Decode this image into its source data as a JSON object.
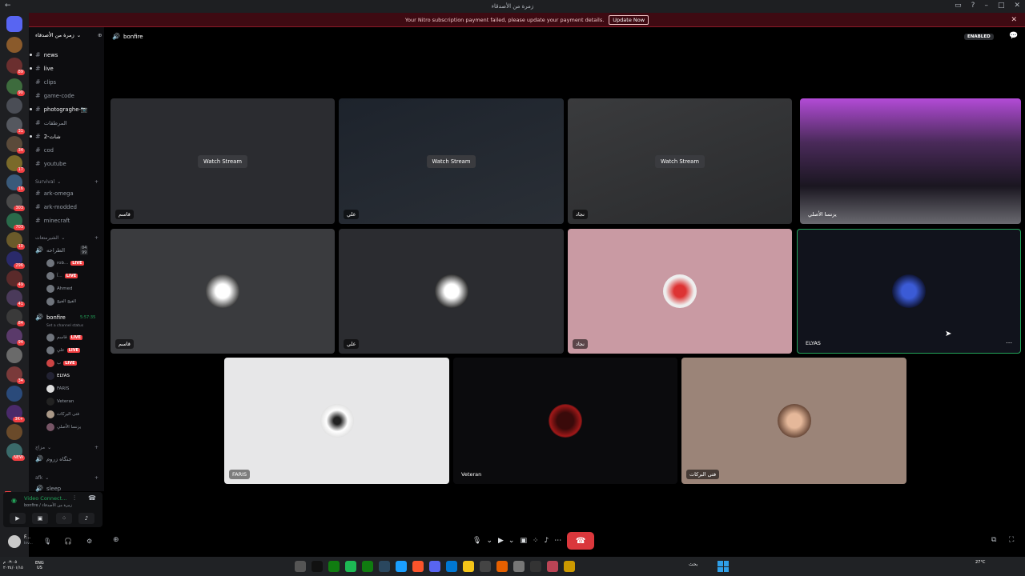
{
  "window": {
    "title": "زمرة من الأصدقاء"
  },
  "banner": {
    "message": "Your Nitro subscription payment failed, please update your payment details.",
    "button": "Update Now"
  },
  "server": {
    "name": "زمرة من الأصدقاء"
  },
  "guild_badges": [
    "89",
    "90",
    "31",
    "34",
    "17",
    "16",
    "303",
    "703",
    "10",
    "296",
    "49",
    "41",
    "84",
    "94",
    "34",
    "3K+",
    "NEW"
  ],
  "channels": [
    "news",
    "live",
    "clips",
    "game-code",
    "photograghe-📷",
    "المرطقات",
    "شات-2",
    "cod",
    "youtube"
  ],
  "categories": {
    "survival": "Survival",
    "voice": "الشيرمتعات",
    "misc": "مزاج",
    "afk": "afk"
  },
  "survival_channels": [
    "ark-omega",
    "ark-modded",
    "minecraft"
  ],
  "voice_channel_1": {
    "name": "الطراحه",
    "count": "04 99"
  },
  "voice_channel_1_users": [
    {
      "name": "rob...",
      "live": "LIVE"
    },
    {
      "name": "آ...",
      "live": "LIVE"
    },
    {
      "name": "Ahmed",
      "live": ""
    },
    {
      "name": "الفيج الفيج",
      "live": ""
    }
  ],
  "bonfire": {
    "name": "bonfire",
    "timer": "5:57:35",
    "status": "Set a channel status"
  },
  "bonfire_users": [
    {
      "name": "قاسم",
      "live": "LIVE"
    },
    {
      "name": "علي",
      "live": "LIVE"
    },
    {
      "name": "ب",
      "live": "LIVE"
    },
    {
      "name": "ELYAS",
      "live": ""
    },
    {
      "name": "FARIS",
      "live": ""
    },
    {
      "name": "Veteran",
      "live": ""
    },
    {
      "name": "فتى البركات",
      "live": ""
    },
    {
      "name": "يزنسا الأصلي",
      "live": ""
    }
  ],
  "misc_channel": "جنگاه زروم",
  "afk_channel": "sleep",
  "voice_status": {
    "title": "Video Connect...",
    "sub": "bonfire / زمرة من الأصدقاء"
  },
  "user": {
    "name": "F...",
    "status": "Inv..."
  },
  "topbar": {
    "channel": "bonfire",
    "enabled": "ENABLED"
  },
  "tiles": {
    "t1": {
      "label": "قاسم",
      "button": "Watch Stream"
    },
    "t2": {
      "label": "علي",
      "button": "Watch Stream"
    },
    "t3": {
      "label": "نجاد",
      "button": "Watch Stream"
    },
    "t4": {
      "label": "يزنسا الأصلي"
    },
    "t5": {
      "label": "قاسم"
    },
    "t6": {
      "label": "علي"
    },
    "t7": {
      "label": "نجاد"
    },
    "t8": {
      "label": "ELYAS"
    },
    "t9": {
      "label": "FARIS"
    },
    "t10": {
      "label": "Veteran"
    },
    "t11": {
      "label": "فتى البركات"
    }
  },
  "taskbar": {
    "lang": "ENG\nUS",
    "time": "٠٣:٠٥ م",
    "date": "٢٠٢٤/٠١/١٥",
    "weather": "27°C",
    "search": "بحث"
  }
}
